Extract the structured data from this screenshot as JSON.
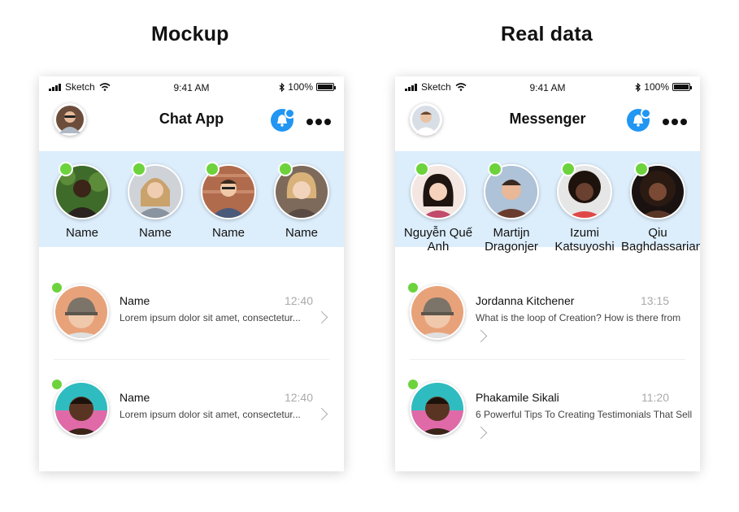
{
  "headings": {
    "left": "Mockup",
    "right": "Real data"
  },
  "status": {
    "carrier": "Sketch",
    "time": "9:41 AM",
    "battery": "100%"
  },
  "mockup": {
    "title": "Chat App",
    "stories": [
      {
        "name": "Name"
      },
      {
        "name": "Name"
      },
      {
        "name": "Name"
      },
      {
        "name": "Name"
      }
    ],
    "chats": [
      {
        "name": "Name",
        "time": "12:40",
        "message": "Lorem ipsum dolor sit amet, consectetur..."
      },
      {
        "name": "Name",
        "time": "12:40",
        "message": "Lorem ipsum dolor sit amet, consectetur..."
      }
    ]
  },
  "real": {
    "title": "Messenger",
    "stories": [
      {
        "name": "Nguyễn Quế Anh"
      },
      {
        "name": "Martijn Dragonjer"
      },
      {
        "name": "Izumi Katsuyoshi"
      },
      {
        "name": "Qiu Baghdassarian"
      }
    ],
    "chats": [
      {
        "name": "Jordanna Kitchener",
        "time": "13:15",
        "message": "What is the loop of Creation? How is there from"
      },
      {
        "name": "Phakamile Sikali",
        "time": "11:20",
        "message": "6 Powerful Tips To Creating Testimonials That Sell"
      }
    ]
  },
  "colors": {
    "accent": "#2196f3",
    "online": "#6dd33d",
    "stories_bg": "#dcedfb"
  },
  "icons": {
    "bell": "bell-icon",
    "more": "more-dots-icon",
    "wifi": "wifi-icon",
    "bluetooth": "bluetooth-icon",
    "chevron": "chevron-right-icon"
  }
}
